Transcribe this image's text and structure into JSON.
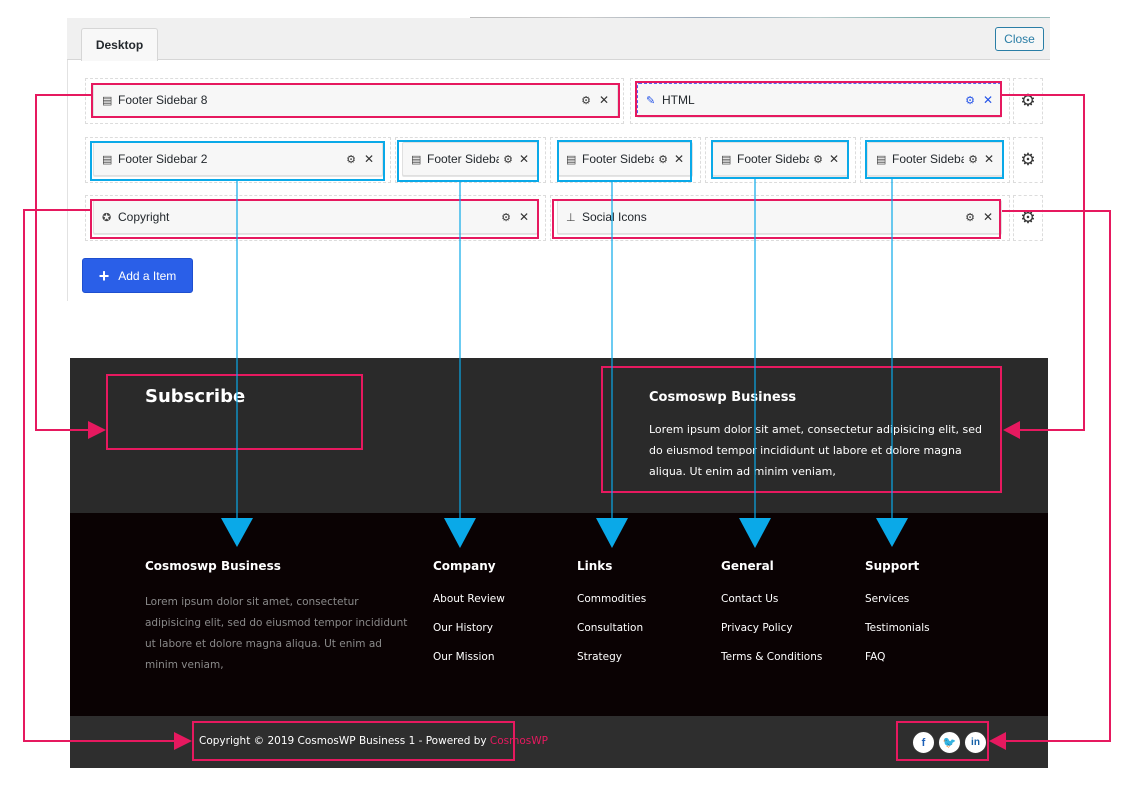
{
  "builder": {
    "tab_label": "Desktop",
    "close_label": "Close",
    "add_item_label": "Add a Item",
    "rows": [
      {
        "widgets": [
          {
            "icon": "sidebar-icon",
            "label": "Footer Sidebar 8"
          },
          {
            "icon": "pencil-icon",
            "label": "HTML"
          }
        ]
      },
      {
        "widgets": [
          {
            "icon": "sidebar-icon",
            "label": "Footer Sidebar 2"
          },
          {
            "icon": "sidebar-icon",
            "label": "Footer Sidebar"
          },
          {
            "icon": "sidebar-icon",
            "label": "Footer Sidebar"
          },
          {
            "icon": "sidebar-icon",
            "label": "Footer Sidebar"
          },
          {
            "icon": "sidebar-icon",
            "label": "Footer Sidebar"
          }
        ]
      },
      {
        "widgets": [
          {
            "icon": "award-icon",
            "label": "Copyright"
          },
          {
            "icon": "sitemap-icon",
            "label": "Social Icons"
          }
        ]
      }
    ]
  },
  "preview": {
    "top": {
      "subscribe_title": "Subscribe",
      "html_title": "Cosmoswp Business",
      "html_text": "Lorem ipsum dolor sit amet, consectetur adipisicing elit, sed do eiusmod tempor incididunt ut labore et dolore magna aliqua. Ut enim ad minim veniam,"
    },
    "main": {
      "about": {
        "title": "Cosmoswp Business",
        "text": "Lorem ipsum dolor sit amet, consectetur adipisicing elit, sed do eiusmod tempor incididunt ut labore et dolore magna aliqua. Ut enim ad minim veniam,"
      },
      "columns": [
        {
          "title": "Company",
          "links": [
            "About Review",
            "Our History",
            "Our Mission"
          ]
        },
        {
          "title": "Links",
          "links": [
            "Commodities",
            "Consultation",
            "Strategy"
          ]
        },
        {
          "title": "General",
          "links": [
            "Contact Us",
            "Privacy Policy",
            "Terms & Conditions"
          ]
        },
        {
          "title": "Support",
          "links": [
            "Services",
            "Testimonials",
            "FAQ"
          ]
        }
      ]
    },
    "bottom": {
      "copyright_text": "Copyright © 2019 CosmosWP Business 1 - Powered by ",
      "copyright_brand": "CosmosWP",
      "social": [
        {
          "name": "facebook",
          "glyph": "f",
          "color": "#1c5fb8"
        },
        {
          "name": "twitter",
          "glyph": "t",
          "color": "#3ea7e6"
        },
        {
          "name": "linkedin",
          "glyph": "in",
          "color": "#1560a8"
        }
      ]
    }
  },
  "annotation_colors": {
    "pink": "#e6195f",
    "blue": "#0aa9e8"
  }
}
